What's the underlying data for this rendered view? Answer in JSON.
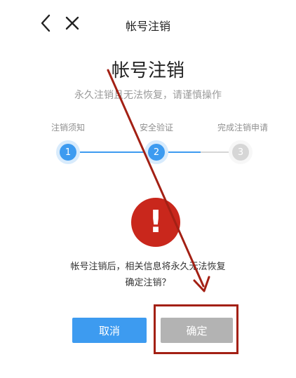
{
  "header": {
    "title": "帐号注销"
  },
  "main": {
    "title": "帐号注销",
    "subtitle": "永久注销且无法恢复，请谨慎操作"
  },
  "steps": [
    {
      "label": "注销须知",
      "number": "1",
      "state": "done"
    },
    {
      "label": "安全验证",
      "number": "2",
      "state": "current"
    },
    {
      "label": "完成注销申请",
      "number": "3",
      "state": "pending"
    }
  ],
  "warning": {
    "icon": "exclamation-icon",
    "symbol": "!",
    "line1": "帐号注销后，相关信息将永久无法恢复",
    "line2": "确定注销？"
  },
  "buttons": {
    "cancel_label": "取消",
    "confirm_label": "确定"
  },
  "colors": {
    "accent_blue": "#3d9bf0",
    "step_pending": "#d6d6d6",
    "warning_red": "#c9271c",
    "annotation_red": "#a32014",
    "cancel_button": "#3d9bf0",
    "confirm_button": "#b3b3b3"
  }
}
